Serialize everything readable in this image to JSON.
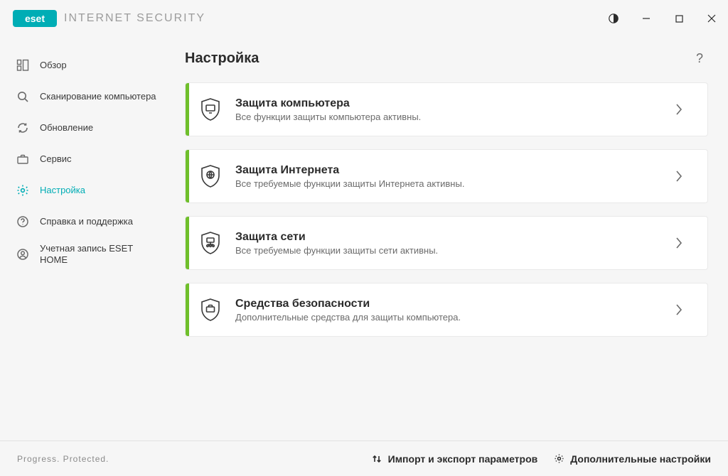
{
  "brand": {
    "badge": "eset",
    "product": "INTERNET SECURITY"
  },
  "sidebar": {
    "items": [
      {
        "label": "Обзор"
      },
      {
        "label": "Сканирование компьютера"
      },
      {
        "label": "Обновление"
      },
      {
        "label": "Сервис"
      },
      {
        "label": "Настройка"
      },
      {
        "label": "Справка и поддержка"
      },
      {
        "label": "Учетная запись ESET HOME"
      }
    ],
    "active_index": 4
  },
  "page": {
    "title": "Настройка",
    "help_glyph": "?"
  },
  "cards": [
    {
      "title": "Защита компьютера",
      "subtitle": "Все функции защиты компьютера активны.",
      "status_color": "#6fbf2b"
    },
    {
      "title": "Защита Интернета",
      "subtitle": "Все требуемые функции защиты Интернета активны.",
      "status_color": "#6fbf2b"
    },
    {
      "title": "Защита сети",
      "subtitle": "Все требуемые функции защиты сети активны.",
      "status_color": "#6fbf2b"
    },
    {
      "title": "Средства безопасности",
      "subtitle": "Дополнительные средства для защиты компьютера.",
      "status_color": "#6fbf2b"
    }
  ],
  "footer": {
    "tagline": "Progress. Protected.",
    "import_export": "Импорт и экспорт параметров",
    "advanced": "Дополнительные настройки"
  }
}
